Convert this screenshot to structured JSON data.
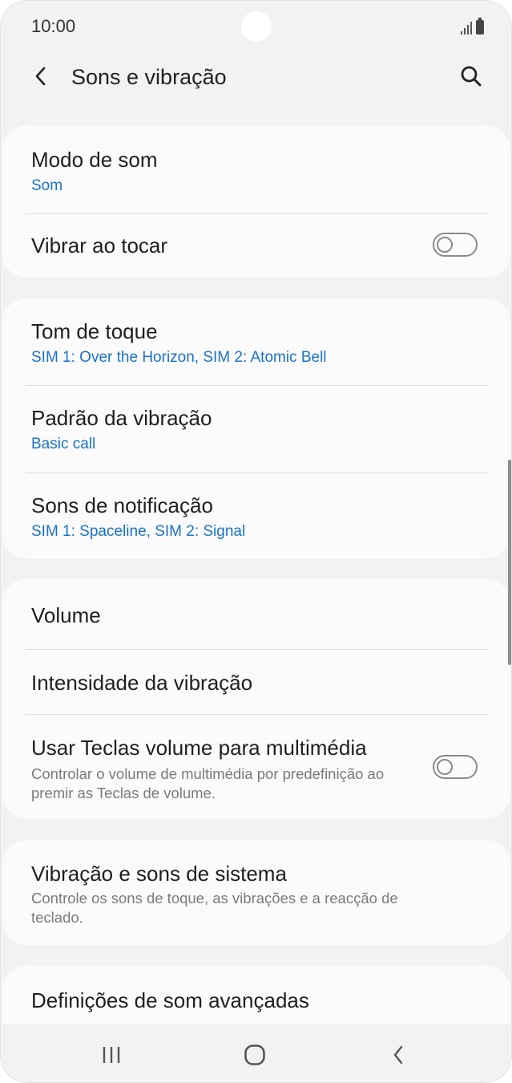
{
  "status_bar": {
    "time": "10:00",
    "icons": [
      "signal-icon",
      "battery-icon"
    ]
  },
  "header": {
    "title": "Sons e vibração",
    "back_icon": "chevron-left-icon",
    "search_icon": "search-icon"
  },
  "sections": [
    {
      "items": [
        {
          "title": "Modo de som",
          "subtitle": "Som"
        },
        {
          "title": "Vibrar ao tocar",
          "toggle": "off"
        }
      ]
    },
    {
      "items": [
        {
          "title": "Tom de toque",
          "subtitle": "SIM 1: Over the Horizon, SIM 2: Atomic Bell"
        },
        {
          "title": "Padrão da vibração",
          "subtitle": "Basic call"
        },
        {
          "title": "Sons de notificação",
          "subtitle": "SIM 1: Spaceline, SIM 2: Signal"
        }
      ]
    },
    {
      "items": [
        {
          "title": "Volume"
        },
        {
          "title": "Intensidade da vibração"
        },
        {
          "title": "Usar Teclas volume para multimédia",
          "description": "Controlar o volume de multimédia por predefinição ao premir as Teclas de volume.",
          "toggle": "off"
        }
      ]
    },
    {
      "items": [
        {
          "title": "Vibração e sons de sistema",
          "description": "Controle os sons de toque, as vibrações e a reacção de teclado."
        }
      ]
    },
    {
      "items": [
        {
          "title": "Definições de som avançadas"
        }
      ]
    }
  ],
  "nav_bar": {
    "buttons": [
      "recent-apps-icon",
      "home-icon",
      "back-icon"
    ]
  },
  "colors": {
    "background": "#f2f2f2",
    "card": "#fbfbfb",
    "accent_subtitle": "#1a73c8",
    "description": "#7a7a7a",
    "toggle_off": "#8a8a8a"
  }
}
